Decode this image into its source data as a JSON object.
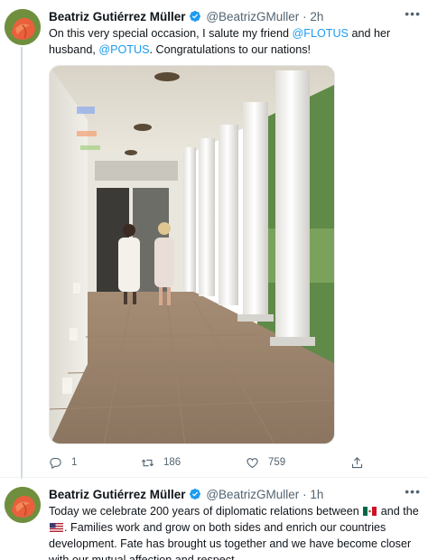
{
  "tweets": [
    {
      "author": {
        "name": "Beatriz Gutiérrez Müller",
        "handle": "@BeatrizGMuller",
        "verified": true
      },
      "time": "2h",
      "text": {
        "part1": "On this very special occasion, I salute my friend ",
        "mention1": "@FLOTUS",
        "part2": " and her husband, ",
        "mention2": "@POTUS",
        "part3": ". Congratulations to our nations!"
      },
      "media": {
        "type": "photo",
        "alt_hint": "two-women-walking-colonnade"
      },
      "stats": {
        "replies": "1",
        "retweets": "186",
        "likes": "759"
      }
    },
    {
      "author": {
        "name": "Beatriz Gutiérrez Müller",
        "handle": "@BeatrizGMuller",
        "verified": true
      },
      "time": "1h",
      "text": {
        "part1": "Today we celebrate 200 years of diplomatic relations between ",
        "part2": " and the ",
        "part3": ". Families work and grow on both sides and enrich our countries development. Fate has brought us together and we have become closer with our mutual affection and respect."
      }
    }
  ],
  "ui": {
    "separator": "·",
    "more": "•••"
  },
  "colors": {
    "accent": "#1d9bf0",
    "muted": "#536471",
    "text": "#0f1419",
    "thread_line": "#cfd9de"
  },
  "icons": [
    "verified-badge-icon",
    "reply-icon",
    "retweet-icon",
    "like-icon",
    "share-icon",
    "mexico-flag-icon",
    "usa-flag-icon",
    "more-icon"
  ]
}
